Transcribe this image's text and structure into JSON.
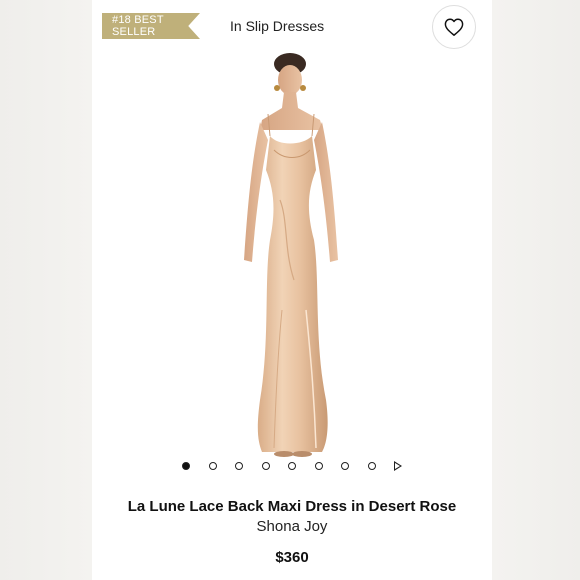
{
  "badge": {
    "label": "#18 BEST SELLER",
    "color": "#bfb07a"
  },
  "breadcrumb": {
    "text": "In Slip Dresses"
  },
  "wishlist": {
    "icon": "heart-icon"
  },
  "carousel": {
    "total": 8,
    "active_index": 0,
    "next_icon": "play-icon"
  },
  "product": {
    "title": "La Lune Lace Back Maxi Dress in Desert Rose",
    "brand": "Shona Joy",
    "price": "$360",
    "dress_color": "#e8c4a4"
  }
}
